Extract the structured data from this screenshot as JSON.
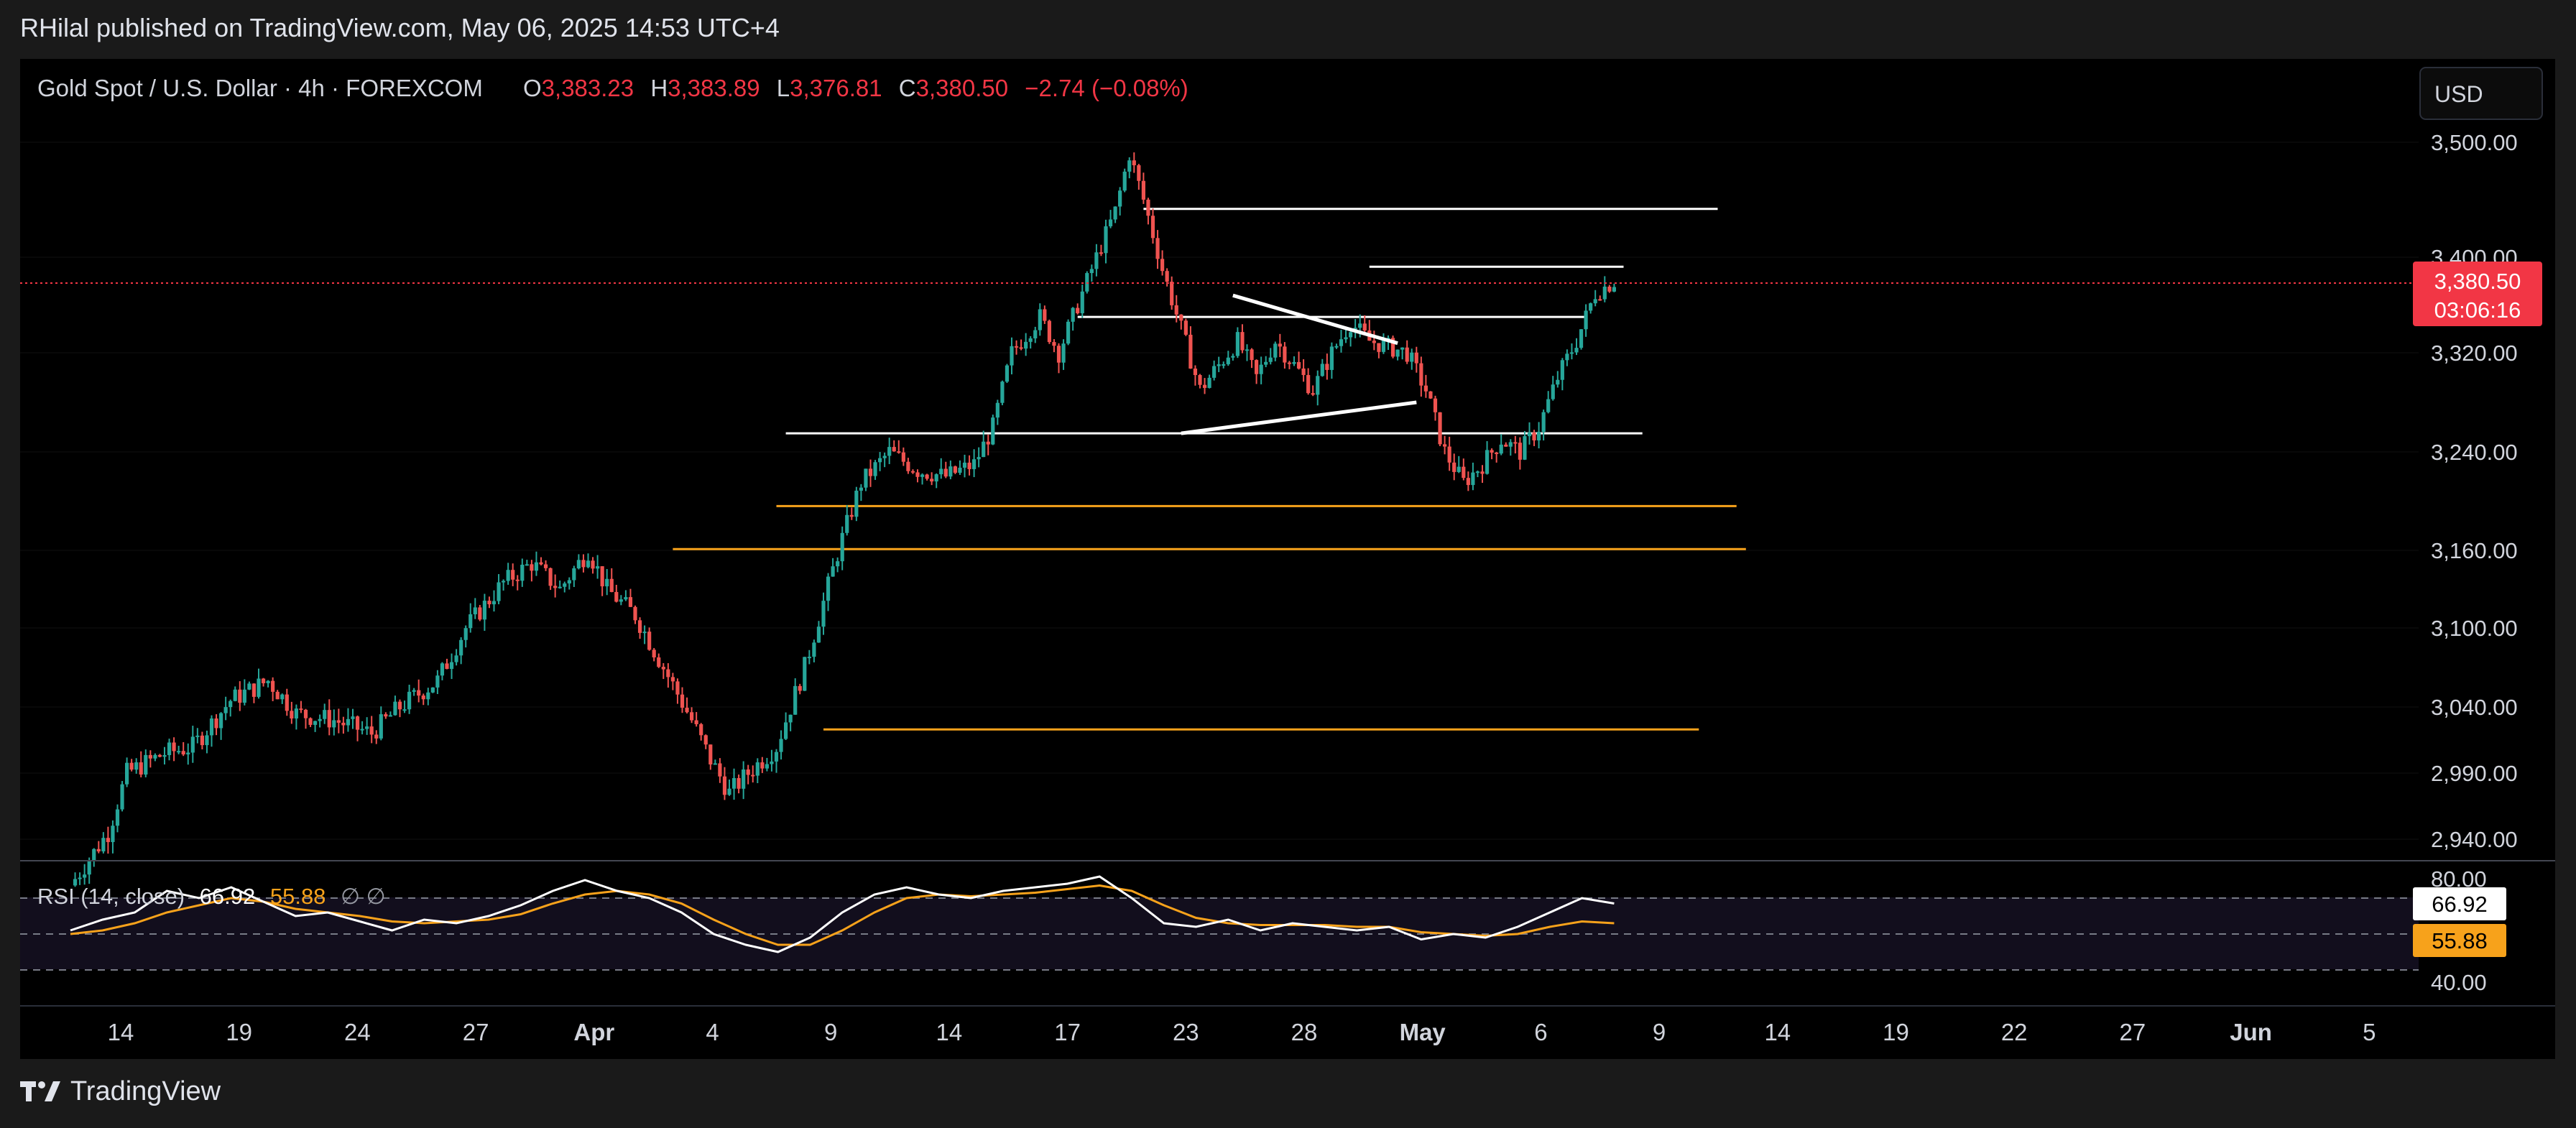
{
  "publisher": "RHilal published on TradingView.com, May 06, 2025 14:53 UTC+4",
  "footer": {
    "brand": "TradingView"
  },
  "colors": {
    "up": "#26a69a",
    "down": "#ef5350",
    "price_tag": "#f23645",
    "rsi_line": "#ffffff",
    "rsi_ma": "#f7a21b",
    "orange_levels": "#f7a21b",
    "white_levels": "#ffffff"
  },
  "legend": {
    "symbol": "Gold Spot / U.S. Dollar · 4h · FOREXCOM",
    "o_label": "O",
    "o_value": "3,383.23",
    "h_label": "H",
    "h_value": "3,383.89",
    "l_label": "L",
    "l_value": "3,376.81",
    "c_label": "C",
    "c_value": "3,380.50",
    "change": "−2.74 (−0.08%)"
  },
  "currency_button": "USD",
  "price_tag": {
    "price": "3,380.50",
    "countdown": "03:06:16"
  },
  "rsi": {
    "label": "RSI (14, close)",
    "value": "66.92",
    "ma_value": "55.88",
    "extra": "∅ ∅",
    "axis_top": "80.00",
    "axis_bottom": "40.00",
    "tag_value": "66.92",
    "tag_ma": "55.88"
  },
  "chart_data": {
    "type": "candlestick",
    "title": "Gold Spot / U.S. Dollar · 4h · FOREXCOM",
    "price_axis_ticks": [
      "3,500.00",
      "3,400.00",
      "3,320.00",
      "3,240.00",
      "3,160.00",
      "3,100.00",
      "3,040.00",
      "2,990.00",
      "2,940.00"
    ],
    "price_axis_values": [
      3500,
      3400,
      3320,
      3240,
      3160,
      3100,
      3040,
      2990,
      2940
    ],
    "time_axis_labels": [
      "14",
      "19",
      "24",
      "27",
      "Apr",
      "4",
      "9",
      "14",
      "17",
      "23",
      "28",
      "May",
      "6",
      "9",
      "14",
      "19",
      "22",
      "27",
      "Jun",
      "5"
    ],
    "bold_time_labels": [
      "Apr",
      "May",
      "Jun"
    ],
    "close_path_points": [
      [
        0,
        2905
      ],
      [
        8,
        2945
      ],
      [
        12,
        2990
      ],
      [
        20,
        3005
      ],
      [
        26,
        3010
      ],
      [
        34,
        3045
      ],
      [
        42,
        3060
      ],
      [
        48,
        3035
      ],
      [
        56,
        3030
      ],
      [
        64,
        3020
      ],
      [
        70,
        3040
      ],
      [
        78,
        3060
      ],
      [
        84,
        3100
      ],
      [
        92,
        3135
      ],
      [
        98,
        3150
      ],
      [
        104,
        3130
      ],
      [
        110,
        3160
      ],
      [
        114,
        3130
      ],
      [
        120,
        3110
      ],
      [
        126,
        3070
      ],
      [
        132,
        3030
      ],
      [
        136,
        3000
      ],
      [
        140,
        2975
      ],
      [
        144,
        2990
      ],
      [
        150,
        3010
      ],
      [
        156,
        3070
      ],
      [
        160,
        3120
      ],
      [
        164,
        3170
      ],
      [
        168,
        3215
      ],
      [
        174,
        3240
      ],
      [
        180,
        3225
      ],
      [
        186,
        3220
      ],
      [
        192,
        3230
      ],
      [
        196,
        3260
      ],
      [
        200,
        3320
      ],
      [
        206,
        3350
      ],
      [
        210,
        3320
      ],
      [
        214,
        3360
      ],
      [
        218,
        3400
      ],
      [
        222,
        3440
      ],
      [
        225,
        3490
      ],
      [
        228,
        3450
      ],
      [
        232,
        3390
      ],
      [
        236,
        3340
      ],
      [
        240,
        3290
      ],
      [
        244,
        3310
      ],
      [
        248,
        3330
      ],
      [
        252,
        3300
      ],
      [
        256,
        3330
      ],
      [
        260,
        3310
      ],
      [
        264,
        3290
      ],
      [
        268,
        3320
      ],
      [
        272,
        3345
      ],
      [
        276,
        3330
      ],
      [
        280,
        3325
      ],
      [
        284,
        3320
      ],
      [
        288,
        3290
      ],
      [
        292,
        3240
      ],
      [
        296,
        3215
      ],
      [
        300,
        3230
      ],
      [
        304,
        3250
      ],
      [
        308,
        3240
      ],
      [
        312,
        3260
      ],
      [
        316,
        3300
      ],
      [
        320,
        3330
      ],
      [
        324,
        3370
      ],
      [
        328,
        3380
      ]
    ],
    "levels": [
      {
        "price": 3442,
        "color": "white",
        "from_step": 228,
        "to_step": 350
      },
      {
        "price": 3392,
        "color": "white",
        "from_step": 276,
        "to_step": 330
      },
      {
        "price": 3350,
        "color": "white",
        "from_step": 214,
        "to_step": 322
      },
      {
        "price": 3255,
        "color": "white",
        "from_step": 152,
        "to_step": 334
      },
      {
        "price": 3196,
        "color": "orange",
        "from_step": 150,
        "to_step": 354
      },
      {
        "price": 3161,
        "color": "orange",
        "from_step": 128,
        "to_step": 356
      },
      {
        "price": 3023,
        "color": "orange",
        "from_step": 160,
        "to_step": 346
      }
    ],
    "trendlines": [
      {
        "from": [
          247,
          3368
        ],
        "to": [
          282,
          3328
        ]
      },
      {
        "from": [
          236,
          3255
        ],
        "to": [
          286,
          3280
        ]
      }
    ],
    "rsi_values": [
      52,
      58,
      62,
      74,
      70,
      76,
      68,
      60,
      62,
      57,
      52,
      58,
      56,
      60,
      66,
      74,
      80,
      74,
      70,
      62,
      50,
      44,
      40,
      48,
      62,
      72,
      76,
      72,
      70,
      74,
      76,
      78,
      82,
      70,
      56,
      54,
      58,
      52,
      56,
      54,
      52,
      54,
      47,
      50,
      48,
      54,
      62,
      70,
      67
    ],
    "rsi_ma_values": [
      50,
      52,
      56,
      62,
      66,
      70,
      68,
      64,
      62,
      60,
      57,
      56,
      57,
      58,
      61,
      67,
      72,
      74,
      72,
      67,
      58,
      50,
      44,
      44,
      52,
      62,
      70,
      72,
      71,
      72,
      73,
      75,
      77,
      74,
      66,
      59,
      56,
      55,
      55,
      55,
      54,
      54,
      51,
      50,
      49,
      50,
      54,
      57,
      56
    ],
    "rsi_levels": [
      70,
      50,
      30
    ]
  }
}
